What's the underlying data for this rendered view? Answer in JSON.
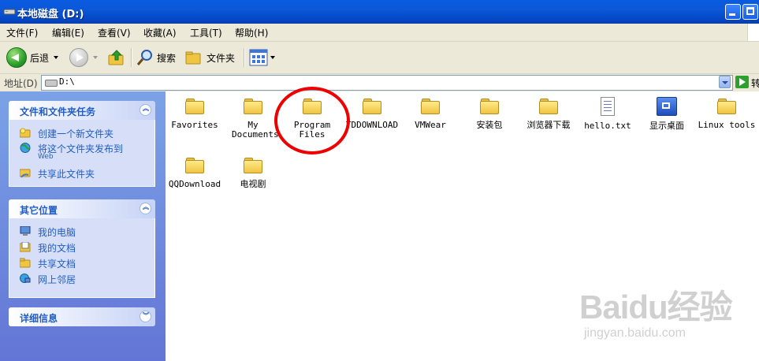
{
  "window": {
    "title": "本地磁盘 (D:)"
  },
  "menu": [
    "文件(F)",
    "编辑(E)",
    "查看(V)",
    "收藏(A)",
    "工具(T)",
    "帮助(H)"
  ],
  "toolbar": {
    "back_label": "后退",
    "search_label": "搜索",
    "folders_label": "文件夹"
  },
  "address": {
    "label": "地址(D)",
    "value": "D:\\",
    "go_label": "转"
  },
  "panels": {
    "tasks": {
      "title": "文件和文件夹任务",
      "items": [
        "创建一个新文件夹",
        "将这个文件夹发布到",
        "Web",
        "共享此文件夹"
      ]
    },
    "places": {
      "title": "其它位置",
      "items": [
        "我的电脑",
        "我的文档",
        "共享文档",
        "网上邻居"
      ]
    },
    "details": {
      "title": "详细信息"
    }
  },
  "files": [
    {
      "name": "Favorites",
      "type": "folder"
    },
    {
      "name": "My Documents",
      "type": "folder"
    },
    {
      "name": "Program Files",
      "type": "folder"
    },
    {
      "name": "TDDOWNLOAD",
      "type": "folder"
    },
    {
      "name": "VMWear",
      "type": "folder"
    },
    {
      "name": "安装包",
      "type": "folder"
    },
    {
      "name": "浏览器下载",
      "type": "folder"
    },
    {
      "name": "hello.txt",
      "type": "text-file"
    },
    {
      "name": "显示桌面",
      "type": "desktop-shortcut"
    },
    {
      "name": "Linux tools",
      "type": "folder"
    },
    {
      "name": "QQDownload",
      "type": "folder"
    },
    {
      "name": "电视剧",
      "type": "folder"
    }
  ],
  "watermark": {
    "brand": "Baidu经验",
    "url": "jingyan.baidu.com"
  },
  "colors": {
    "titlebar": "#0a5be0",
    "panel_bg": "#6375d6",
    "panel_link": "#215dc6",
    "highlight_ring": "#e00000"
  }
}
